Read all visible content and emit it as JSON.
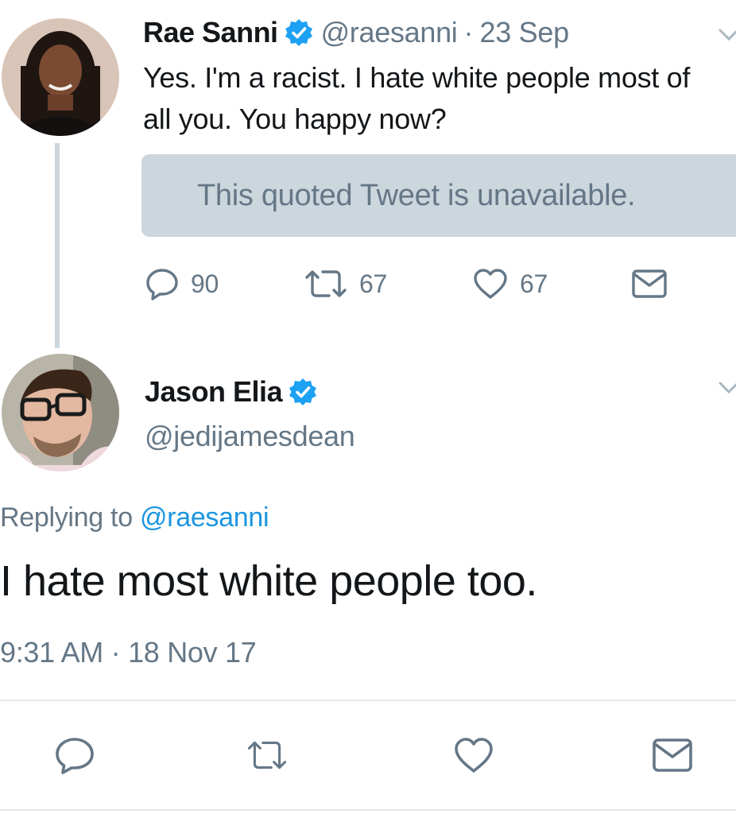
{
  "parent_tweet": {
    "author_name": "Rae Sanni",
    "handle": "@raesanni",
    "separator": "·",
    "date": "23 Sep",
    "text": "Yes. I'm a racist. I hate white people most of all you. You happy now?",
    "quoted_tweet_notice": "This quoted Tweet is unavailable.",
    "reply_count": "90",
    "retweet_count": "67",
    "like_count": "67"
  },
  "reply_tweet": {
    "author_name": "Jason Elia",
    "handle": "@jedijamesdean",
    "replying_to_label": "Replying to",
    "replying_to_handle": "@raesanni",
    "text": "I hate most white people too.",
    "timestamp": "9:31 AM · 18 Nov 17"
  },
  "icons": {
    "verified": "verified-badge-icon",
    "caret": "chevron-down-icon",
    "reply": "reply-icon",
    "retweet": "retweet-icon",
    "like": "heart-icon",
    "dm": "envelope-icon"
  },
  "colors": {
    "text": "#14171a",
    "secondary": "#657786",
    "link": "#1b95e0",
    "verified": "#1da1f2",
    "quoted_bg": "#ccd6dd",
    "thread_line": "#ccd6dd",
    "divider": "#e1e8ed"
  }
}
